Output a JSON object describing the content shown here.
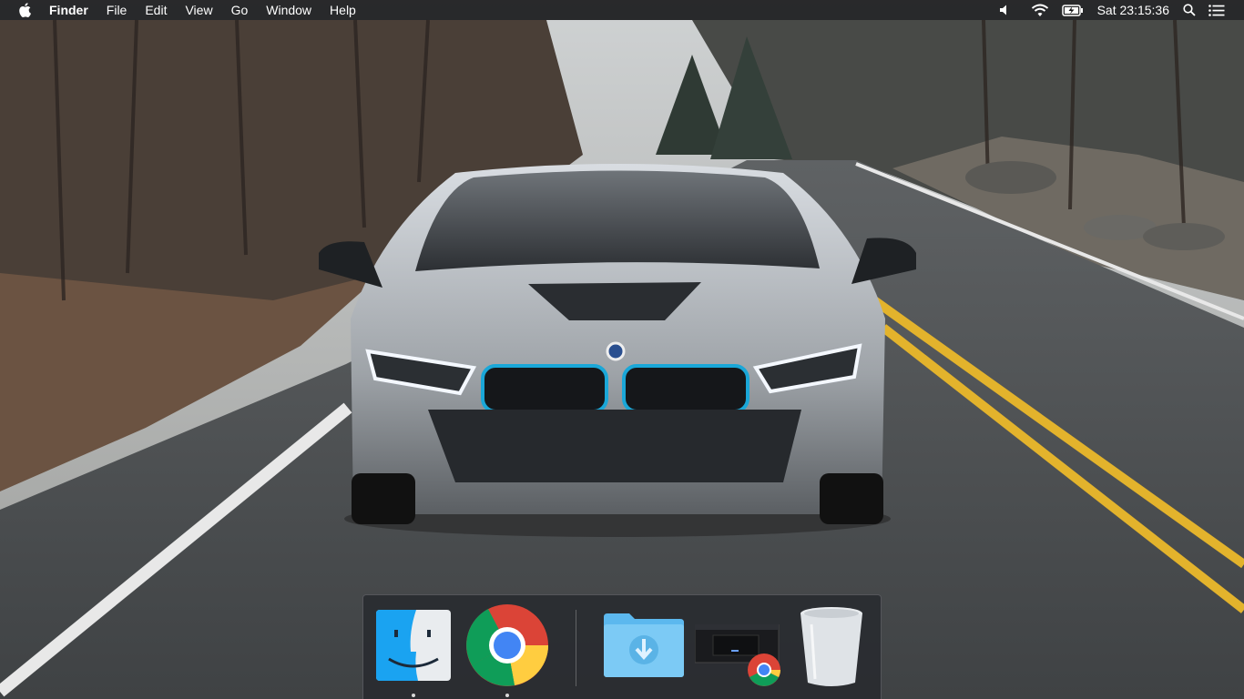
{
  "menubar": {
    "apple_icon": "apple-icon",
    "app_name": "Finder",
    "menus": [
      "File",
      "Edit",
      "View",
      "Go",
      "Window",
      "Help"
    ],
    "status": {
      "volume_icon": "speaker-icon",
      "wifi_icon": "wifi-icon",
      "battery_icon": "battery-charging-icon",
      "clock": "Sat 23:15:36",
      "spotlight_icon": "search-icon",
      "notification_icon": "notification-list-icon"
    }
  },
  "wallpaper": {
    "description_icon": "car-on-road-wallpaper"
  },
  "dock": {
    "apps": [
      {
        "name": "Finder",
        "icon": "finder-icon",
        "running": true
      },
      {
        "name": "Google Chrome",
        "icon": "chrome-icon",
        "running": true
      }
    ],
    "others": [
      {
        "name": "Downloads",
        "icon": "downloads-folder-icon"
      },
      {
        "name": "Minimized Chrome window",
        "icon": "minimized-window-icon"
      },
      {
        "name": "Trash",
        "icon": "trash-icon"
      }
    ]
  },
  "colors": {
    "menubar_bg": "#161618",
    "dock_bg": "#282a2e",
    "road_line_yellow": "#e3b32c",
    "car_accent_blue": "#1aa7d8"
  }
}
